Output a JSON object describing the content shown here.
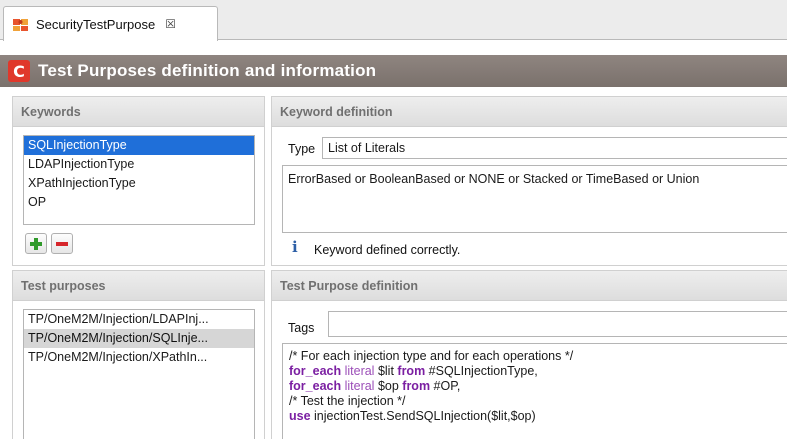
{
  "editor_tab": {
    "label": "SecurityTestPurpose",
    "close_glyph": "☒",
    "icon": "puzzle-icon"
  },
  "form": {
    "logo_letter": "C",
    "title": "Test Purposes definition and information"
  },
  "keywords": {
    "title": "Keywords",
    "items": [
      "SQLInjectionType",
      "LDAPInjectionType",
      "XPathInjectionType",
      "OP"
    ],
    "selected_index": 0,
    "add_icon": "plus-icon",
    "remove_icon": "minus-icon"
  },
  "keyword_definition": {
    "title": "Keyword definition",
    "type_label": "Type",
    "type_value": "List of Literals",
    "literals": "ErrorBased or BooleanBased or NONE or Stacked or TimeBased or Union",
    "status_icon_glyph": "i",
    "status_text": "Keyword defined correctly."
  },
  "test_purposes": {
    "title": "Test purposes",
    "items": [
      "TP/OneM2M/Injection/LDAPInj...",
      "TP/OneM2M/Injection/SQLInje...",
      "TP/OneM2M/Injection/XPathIn..."
    ],
    "selected_index": 1
  },
  "test_purpose_definition": {
    "title": "Test Purpose definition",
    "tags_label": "Tags",
    "tags_value": "",
    "code": {
      "line1": "/* For each injection type and for each operations */",
      "line2_kw1": "for_each",
      "line2_kw2": "literal",
      "line2_var": " $lit ",
      "line2_kw3": "from",
      "line2_rest": " #SQLInjectionType,",
      "line3_kw1": "for_each",
      "line3_kw2": "literal",
      "line3_var": " $op ",
      "line3_kw3": "from",
      "line3_rest": " #OP,",
      "line4": "/* Test the injection */",
      "line5_kw": "use",
      "line5_rest": " injectionTest.SendSQLInjection($lit,$op)"
    }
  },
  "colors": {
    "selection_blue": "#1f6fd9",
    "header_grey": "#7a716c",
    "keyword_purple": "#7b1fa2",
    "logo_red": "#e0382b"
  }
}
